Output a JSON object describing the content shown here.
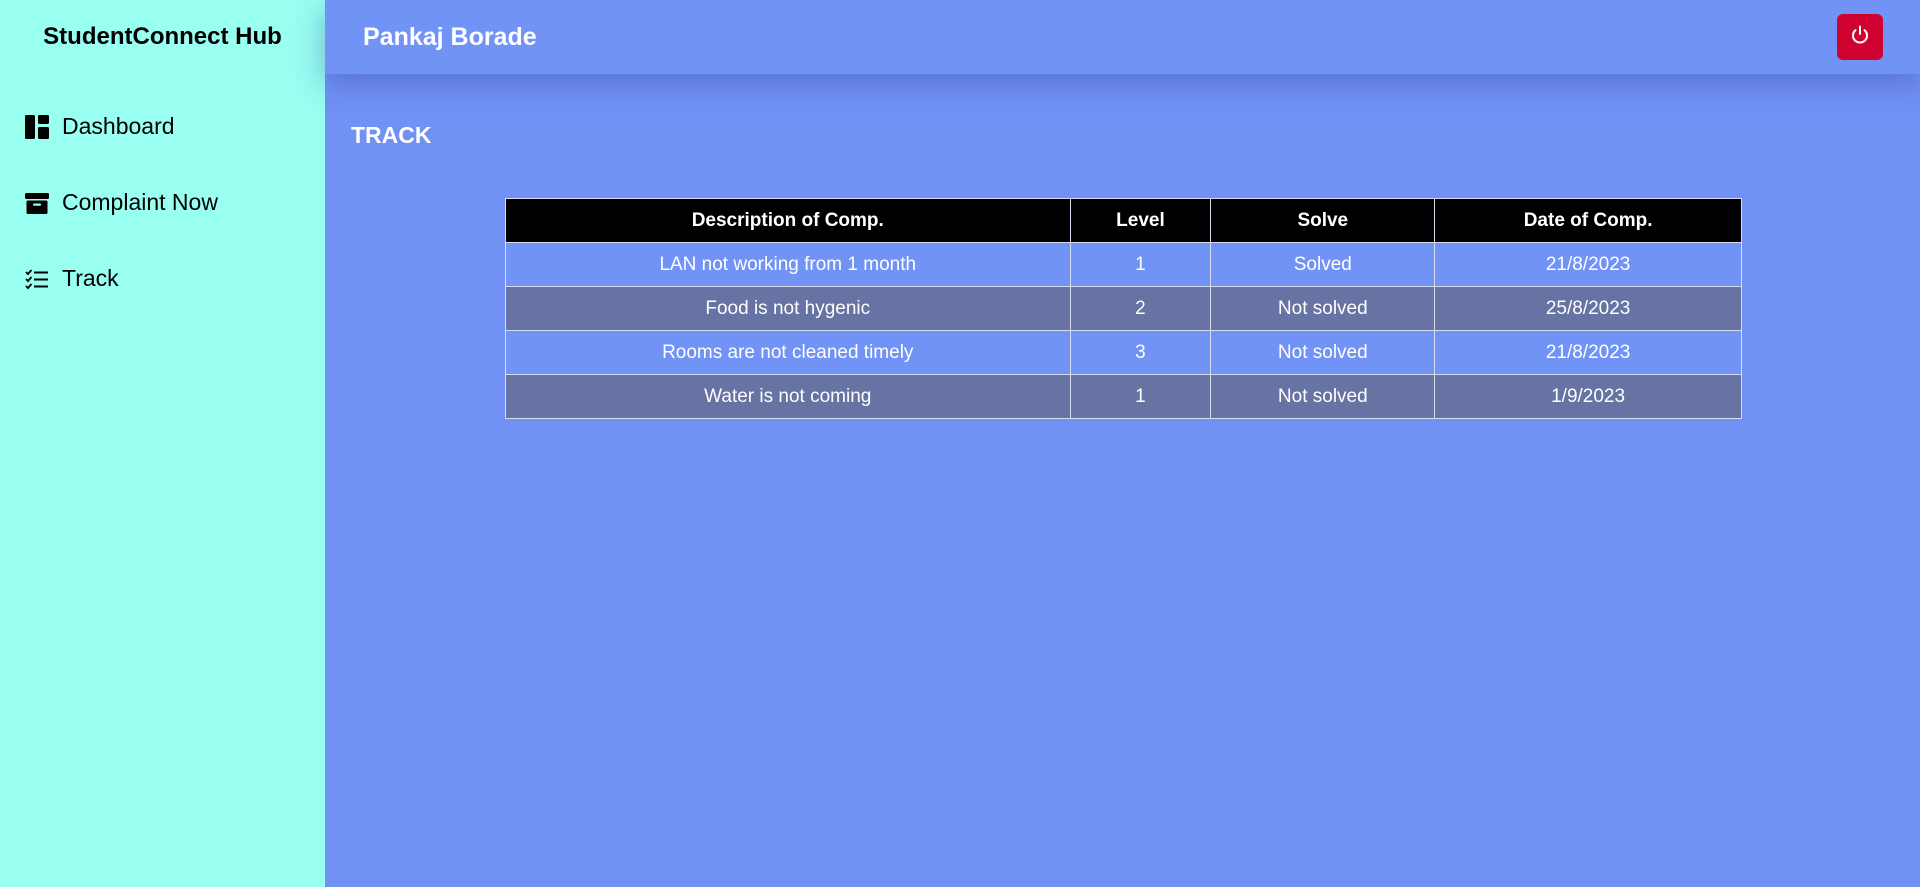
{
  "sidebar": {
    "brand": "StudentConnect Hub",
    "items": [
      {
        "label": "Dashboard",
        "icon": "dashboard-icon"
      },
      {
        "label": "Complaint Now",
        "icon": "archive-box-icon"
      },
      {
        "label": "Track",
        "icon": "checklist-icon"
      }
    ]
  },
  "header": {
    "user_name": "Pankaj Borade",
    "logout_icon": "power-icon"
  },
  "main": {
    "title": "TRACK",
    "table": {
      "headers": [
        "Description of Comp.",
        "Level",
        "Solve",
        "Date of Comp."
      ],
      "rows": [
        [
          "LAN not working from 1 month",
          "1",
          "Solved",
          "21/8/2023"
        ],
        [
          "Food is not hygenic",
          "2",
          "Not solved",
          "25/8/2023"
        ],
        [
          "Rooms are not cleaned timely",
          "3",
          "Not solved",
          "21/8/2023"
        ],
        [
          "Water is not coming",
          "1",
          "Not solved",
          "1/9/2023"
        ]
      ]
    }
  },
  "colors": {
    "sidebar_bg": "#98fff1",
    "main_bg": "#7191f5",
    "logout_button": "#d0022f",
    "table_header": "#000000",
    "row_odd": "#7193f6",
    "row_even": "#6673a3"
  }
}
